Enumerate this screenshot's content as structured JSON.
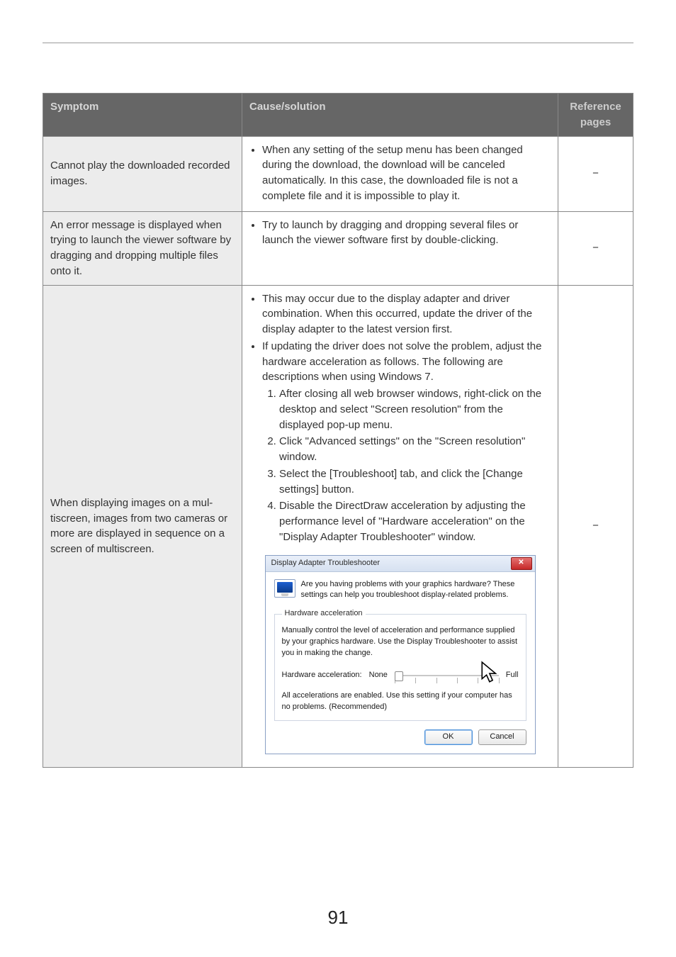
{
  "page_number": "91",
  "headers": {
    "symptom": "Symptom",
    "cause": "Cause/solution",
    "reference": "Reference pages"
  },
  "rows": [
    {
      "symptom": "Cannot play the downloaded recorded images.",
      "cause_bullets": [
        "When any setting of the setup menu has been changed during the download, the download will be canceled automatically. In this case, the downloaded file is not a complete file and it is impossible to play it."
      ],
      "ref": "−"
    },
    {
      "symptom": "An error message is displayed when trying to launch the viewer software by dragging and dropping multiple files onto it.",
      "cause_bullets": [
        "Try to launch by dragging and dropping several files or launch the viewer software first by double-clicking."
      ],
      "ref": "−"
    },
    {
      "symptom": "When displaying images on a mul­tiscreen, images from two cameras or more are displayed in sequence on a screen of multiscreen.",
      "cause_bullets": [
        "This may occur due to the display adapter and driver combination. When this occurred, update the driver of the display adapter to the latest version first.",
        "If updating the driver does not solve the problem, adjust the hardware acceleration as follows. The following are descriptions when using Windows 7."
      ],
      "cause_steps": [
        "After closing all web browser windows, right-click on the desktop and select \"Screen resolution\" from the displayed pop-up menu.",
        "Click \"Advanced settings\" on the \"Screen resolution\" window.",
        "Select the [Troubleshoot] tab, and click the [Change settings] button.",
        "Disable the DirectDraw acceleration by adjusting the performance level of \"Hardware acceleration\" on the \"Display Adapter Troubleshooter\" window."
      ],
      "ref": "−"
    }
  ],
  "dialog": {
    "title": "Display Adapter Troubleshooter",
    "intro": "Are you having problems with your graphics hardware? These settings can help you troubleshoot display-related problems.",
    "group_label": "Hardware acceleration",
    "group_text": "Manually control the level of acceleration and performance supplied by your graphics hardware. Use the Display Troubleshooter to assist you in making the change.",
    "slider_label": "Hardware acceleration:",
    "slider_min": "None",
    "slider_max": "Full",
    "note": "All accelerations are enabled. Use this setting if your computer has no problems. (Recommended)",
    "ok": "OK",
    "cancel": "Cancel",
    "close_glyph": "✕"
  }
}
